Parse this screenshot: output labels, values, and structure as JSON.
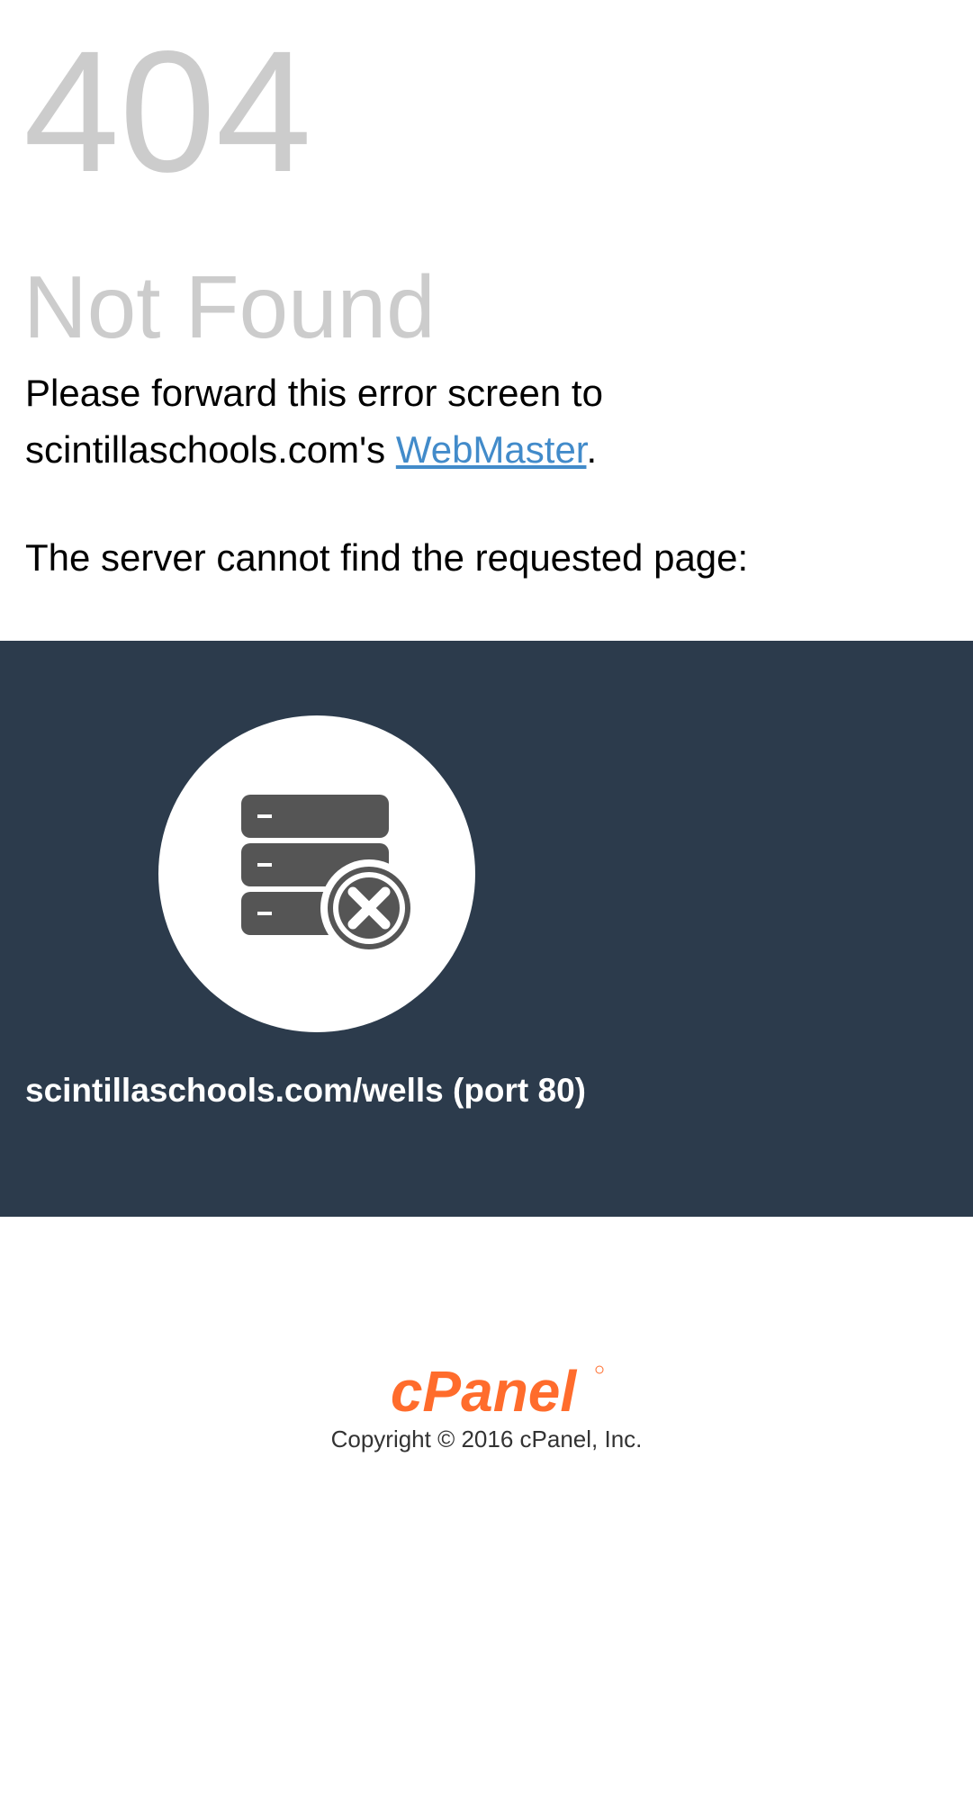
{
  "error": {
    "code": "404",
    "title": "Not Found"
  },
  "message": {
    "line1": "Please forward this error screen to",
    "domain_possessive": "scintillaschools.com's",
    "webmaster_link": "WebMaster",
    "period": ".",
    "server_message": "The server cannot find the requested page:"
  },
  "panel": {
    "icon": "server-error-icon",
    "request_url": "scintillaschools.com/wells (port 80)",
    "background_color": "#2c3b4c"
  },
  "footer": {
    "logo_text": "cPanel",
    "logo_color": "#ff6c2c",
    "copyright": "Copyright © 2016 cPanel, Inc."
  }
}
